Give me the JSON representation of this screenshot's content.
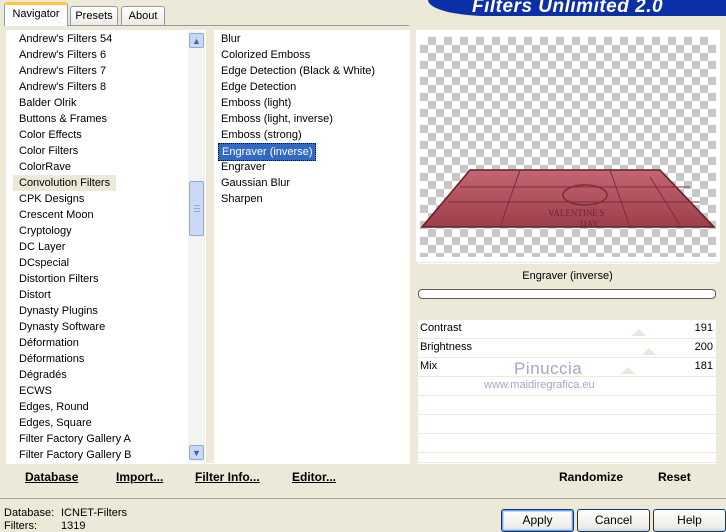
{
  "tabs": [
    {
      "label": "Navigator",
      "active": true
    },
    {
      "label": "Presets",
      "active": false
    },
    {
      "label": "About",
      "active": false
    }
  ],
  "banner_title": "Filters Unlimited 2.0",
  "categories": [
    "Andrew's Filters 54",
    "Andrew's Filters 6",
    "Andrew's Filters 7",
    "Andrew's Filters 8",
    "Balder Olrik",
    "Buttons & Frames",
    "Color Effects",
    "Color Filters",
    "ColorRave",
    "Convolution Filters",
    "CPK Designs",
    "Crescent Moon",
    "Cryptology",
    "DC Layer",
    "DCspecial",
    "Distortion Filters",
    "Distort",
    "Dynasty Plugins",
    "Dynasty Software",
    "Déformation",
    "Déformations",
    "Dégradés",
    "ECWS",
    "Edges, Round",
    "Edges, Square",
    "Filter Factory Gallery A",
    "Filter Factory Gallery B"
  ],
  "selected_category": "Convolution Filters",
  "filters": [
    "Blur",
    "Colorized Emboss",
    "Edge Detection (Black & White)",
    "Edge Detection",
    "Emboss (light)",
    "Emboss (light, inverse)",
    "Emboss (strong)",
    "Engraver (inverse)",
    "Engraver",
    "Gaussian Blur",
    "Sharpen"
  ],
  "selected_filter": "Engraver (inverse)",
  "current_filter_name": "Engraver (inverse)",
  "sliders": [
    {
      "label": "Contrast",
      "value": "191"
    },
    {
      "label": "Brightness",
      "value": "200"
    },
    {
      "label": "Mix",
      "value": "181"
    }
  ],
  "watermark": {
    "line1": "Pinuccia",
    "line2": "www.maidiregrafica.eu"
  },
  "preview_text": {
    "line1": "VALENTINE'S",
    "line2": "DAY"
  },
  "left_buttons": {
    "database": "Database",
    "import": "Import...",
    "filter_info": "Filter Info...",
    "editor": "Editor..."
  },
  "right_buttons": {
    "randomize": "Randomize",
    "reset": "Reset"
  },
  "footer": {
    "database_label": "Database:",
    "database_value": "ICNET-Filters",
    "filters_label": "Filters:",
    "filters_value": "1319"
  },
  "dialog_buttons": {
    "apply": "Apply",
    "cancel": "Cancel",
    "help": "Help"
  },
  "colors": {
    "banner": "#0b2fa6",
    "selection": "#316ac5",
    "preview_surface": "#b8525f"
  }
}
